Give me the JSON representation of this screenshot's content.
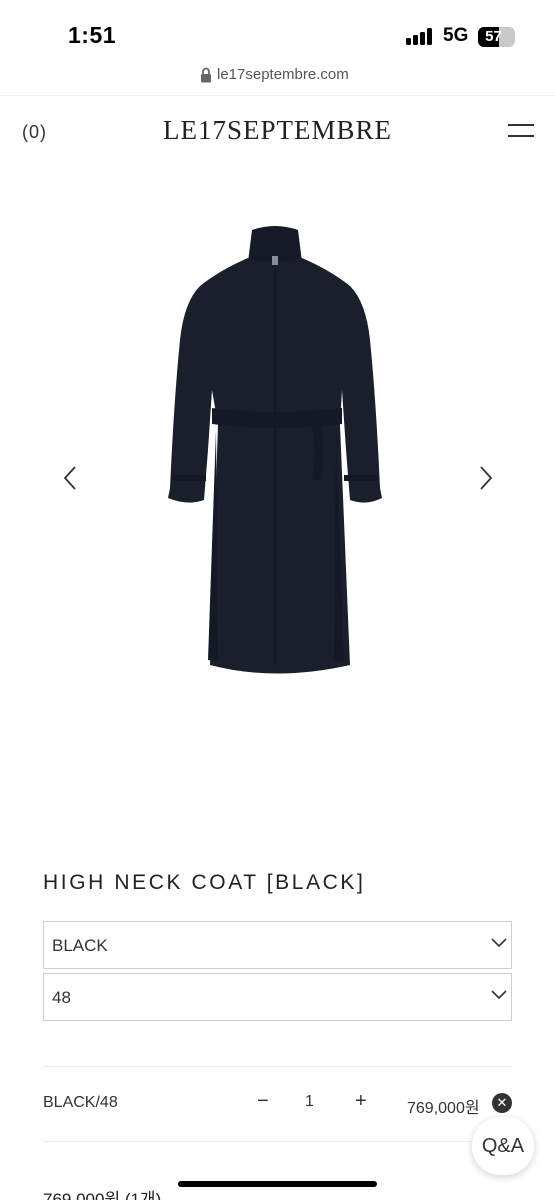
{
  "status": {
    "time": "1:51",
    "network": "5G",
    "battery": "57",
    "battery_level_percent": 57
  },
  "browser": {
    "url": "le17septembre.com"
  },
  "header": {
    "cart": "(0)",
    "brand": "LE17SEPTEMBRE"
  },
  "product": {
    "title": "HIGH NECK COAT [BLACK]",
    "color_select": "BLACK",
    "size_select": "48"
  },
  "selected_option": {
    "label": "BLACK/48",
    "minus": "−",
    "quantity": "1",
    "plus": "+",
    "price": "769,000원",
    "remove": "✕"
  },
  "total": "769,000원 (1개)",
  "qa_button": "Q&A",
  "colors": {
    "coat": "#1b1f2c",
    "text": "#222222",
    "border": "#cfcfcf"
  }
}
